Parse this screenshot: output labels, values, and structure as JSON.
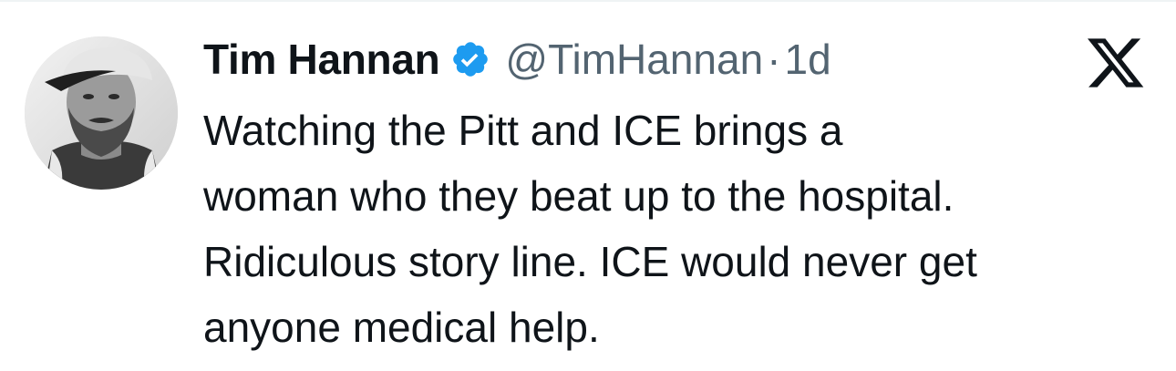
{
  "tweet": {
    "display_name": "Tim Hannan",
    "handle": "@TimHannan",
    "separator": "·",
    "time": "1d",
    "text": "Watching the Pitt and ICE brings a\nwoman who they beat up to the hospital.\nRidiculous story line. ICE would never get\nanyone medical help."
  },
  "icons": {
    "verified": "verified-badge-icon",
    "platform": "x-logo-icon",
    "avatar": "profile-photo"
  },
  "colors": {
    "verified_blue": "#1d9bf0",
    "handle_gray": "#536471",
    "text": "#0f1419"
  }
}
